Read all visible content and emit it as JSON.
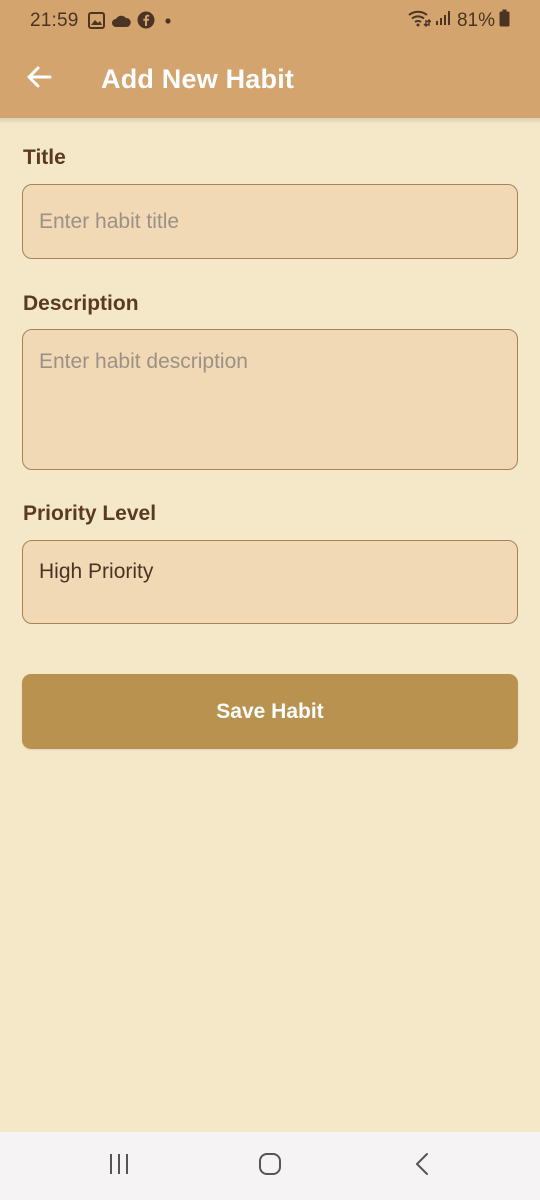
{
  "status_bar": {
    "time": "21:59",
    "battery_percent": "81%",
    "left_icons": [
      "gallery-icon",
      "cloud-icon",
      "facebook-icon",
      "dot-icon"
    ],
    "right_icons": [
      "wifi-icon",
      "signal-icon",
      "battery-icon"
    ]
  },
  "app_bar": {
    "title": "Add New Habit",
    "back_icon": "arrow-left-icon"
  },
  "form": {
    "title": {
      "label": "Title",
      "placeholder": "Enter habit title",
      "value": ""
    },
    "description": {
      "label": "Description",
      "placeholder": "Enter habit description",
      "value": ""
    },
    "priority": {
      "label": "Priority Level",
      "selected": "High Priority"
    },
    "save_label": "Save Habit"
  },
  "nav_bar": {
    "icons": [
      "recent-apps-icon",
      "home-icon",
      "back-icon"
    ]
  },
  "colors": {
    "app_bar": "#d3a46e",
    "background": "#f5e8c9",
    "field_fill": "#f1d9b5",
    "field_border": "#a6825a",
    "label_text": "#5a3a22",
    "button": "#b9924f",
    "nav_bar": "#f5f3f4"
  }
}
